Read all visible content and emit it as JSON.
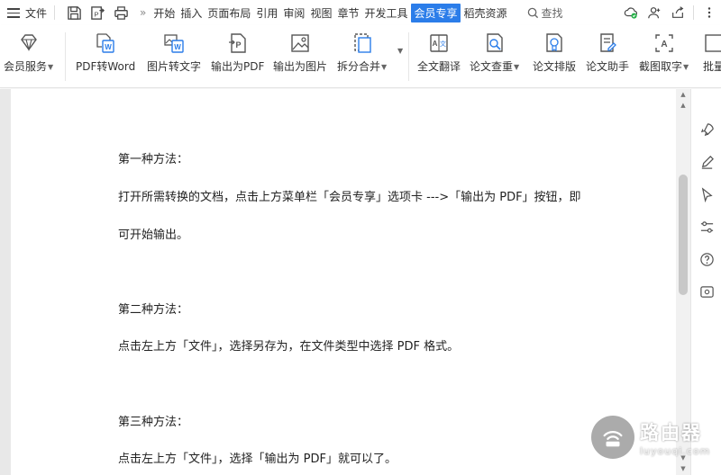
{
  "menubar": {
    "file_label": "文件",
    "more_chevron": "»",
    "tabs": [
      "开始",
      "插入",
      "页面布局",
      "引用",
      "审阅",
      "视图",
      "章节",
      "开发工具",
      "会员专享",
      "稻壳资源"
    ],
    "active_tab": "会员专享",
    "search_label": "查找",
    "accent_color": "#2b7de9"
  },
  "ribbon": {
    "items": [
      {
        "label": "会员服务",
        "icon": "diamond-icon",
        "dropdown": true
      },
      {
        "label": "PDF转Word",
        "icon": "pdf-to-word-icon",
        "dropdown": false
      },
      {
        "label": "图片转文字",
        "icon": "image-to-text-icon",
        "dropdown": false
      },
      {
        "label": "输出为PDF",
        "icon": "export-pdf-icon",
        "dropdown": false
      },
      {
        "label": "输出为图片",
        "icon": "export-image-icon",
        "dropdown": false
      },
      {
        "label": "拆分合并",
        "icon": "split-merge-icon",
        "dropdown": true
      },
      {
        "label": "全文翻译",
        "icon": "translate-icon",
        "dropdown": false
      },
      {
        "label": "论文查重",
        "icon": "plagiarism-check-icon",
        "dropdown": true
      },
      {
        "label": "论文排版",
        "icon": "paper-format-icon",
        "dropdown": false
      },
      {
        "label": "论文助手",
        "icon": "paper-assistant-icon",
        "dropdown": false
      },
      {
        "label": "截图取字",
        "icon": "screenshot-ocr-icon",
        "dropdown": true
      },
      {
        "label": "批量",
        "icon": "batch-icon",
        "dropdown": false
      }
    ]
  },
  "document": {
    "lines": [
      "第一种方法：",
      "打开所需转换的文档，点击上方菜单栏「会员专享」选项卡 --->「输出为 PDF」按钮，即",
      "可开始输出。",
      "第二种方法：",
      "点击左上方「文件」，选择另存为，在文件类型中选择 PDF 格式。",
      "第三种方法：",
      "点击左上方「文件」，选择「输出为 PDF」就可以了。"
    ]
  },
  "watermark": {
    "main": "路由器",
    "sub": "luyouqi.com"
  }
}
